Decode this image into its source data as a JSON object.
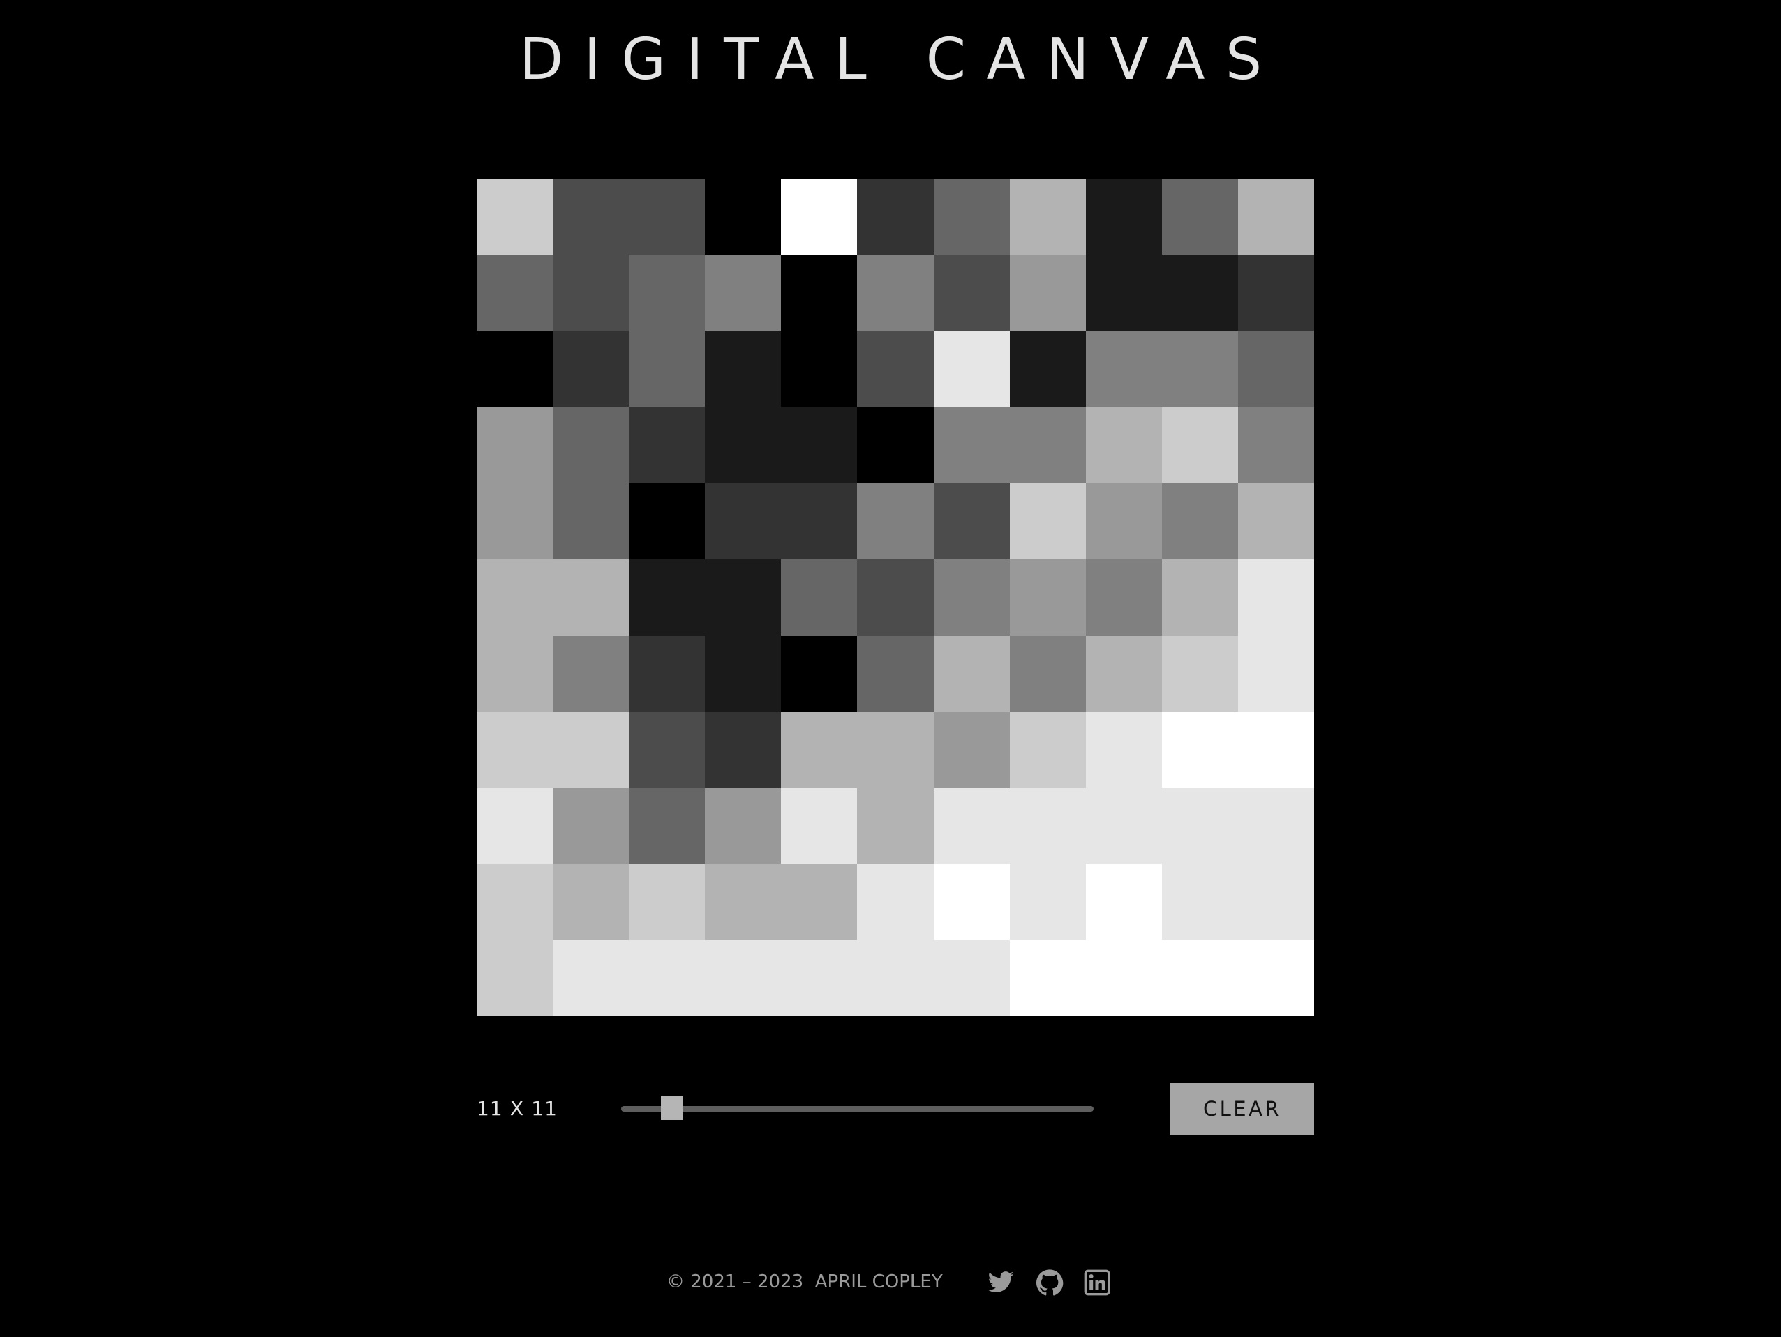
{
  "title": "DIGITAL CANVAS",
  "canvas": {
    "size": 11,
    "cells": [
      [
        "#cccccc",
        "#4c4c4c",
        "#4c4c4c",
        "#000000",
        "#ffffff",
        "#333333",
        "#666666",
        "#b3b3b3",
        "#1a1a1a",
        "#666666",
        "#b3b3b3"
      ],
      [
        "#666666",
        "#4c4c4c",
        "#666666",
        "#808080",
        "#000000",
        "#808080",
        "#4c4c4c",
        "#999999",
        "#1a1a1a",
        "#1a1a1a",
        "#333333"
      ],
      [
        "#000000",
        "#333333",
        "#666666",
        "#1a1a1a",
        "#000000",
        "#4c4c4c",
        "#e6e6e6",
        "#1a1a1a",
        "#808080",
        "#808080",
        "#666666"
      ],
      [
        "#999999",
        "#666666",
        "#333333",
        "#1a1a1a",
        "#1a1a1a",
        "#000000",
        "#808080",
        "#808080",
        "#b3b3b3",
        "#cccccc",
        "#808080"
      ],
      [
        "#999999",
        "#666666",
        "#000000",
        "#333333",
        "#333333",
        "#808080",
        "#4c4c4c",
        "#cccccc",
        "#999999",
        "#808080",
        "#b3b3b3"
      ],
      [
        "#b3b3b3",
        "#b3b3b3",
        "#1a1a1a",
        "#1a1a1a",
        "#666666",
        "#4c4c4c",
        "#808080",
        "#999999",
        "#808080",
        "#b3b3b3",
        "#e6e6e6"
      ],
      [
        "#b3b3b3",
        "#808080",
        "#333333",
        "#1a1a1a",
        "#000000",
        "#666666",
        "#b3b3b3",
        "#808080",
        "#b3b3b3",
        "#cccccc",
        "#e6e6e6"
      ],
      [
        "#cccccc",
        "#cccccc",
        "#4c4c4c",
        "#333333",
        "#b3b3b3",
        "#b3b3b3",
        "#999999",
        "#cccccc",
        "#e6e6e6",
        "#ffffff",
        "#ffffff"
      ],
      [
        "#e6e6e6",
        "#999999",
        "#666666",
        "#999999",
        "#e6e6e6",
        "#b3b3b3",
        "#e6e6e6",
        "#e6e6e6",
        "#e6e6e6",
        "#e6e6e6",
        "#e6e6e6"
      ],
      [
        "#cccccc",
        "#b3b3b3",
        "#cccccc",
        "#b3b3b3",
        "#b3b3b3",
        "#e6e6e6",
        "#ffffff",
        "#e6e6e6",
        "#ffffff",
        "#e6e6e6",
        "#e6e6e6"
      ],
      [
        "#cccccc",
        "#e6e6e6",
        "#e6e6e6",
        "#e6e6e6",
        "#e6e6e6",
        "#e6e6e6",
        "#e6e6e6",
        "#ffffff",
        "#ffffff",
        "#ffffff",
        "#ffffff"
      ]
    ]
  },
  "controls": {
    "size_label": "11 X 11",
    "clear_label": "CLEAR"
  },
  "footer": {
    "copyright": "© 2021 – 2023  APRIL COPLEY",
    "icons": [
      "twitter-icon",
      "github-icon",
      "linkedin-icon"
    ]
  },
  "colors": {
    "background": "#000000",
    "title": "#e4e4e4",
    "button": "#a6a6a6",
    "icon": "#9a9a9a"
  }
}
